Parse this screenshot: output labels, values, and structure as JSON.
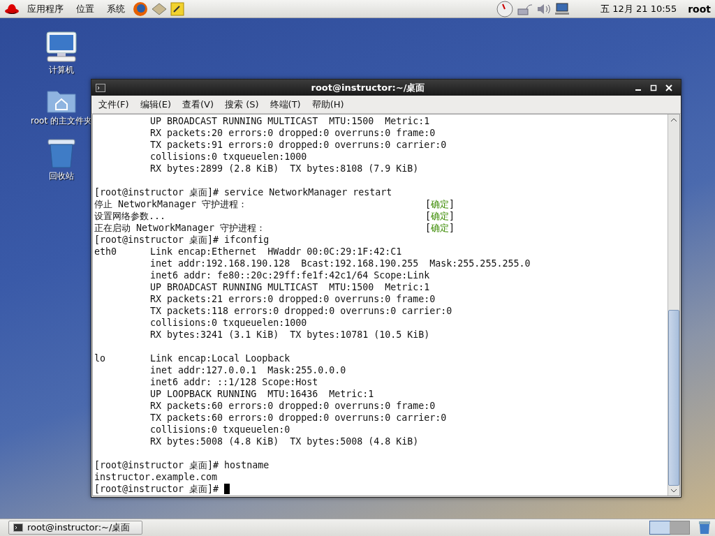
{
  "top_panel": {
    "menus": [
      "应用程序",
      "位置",
      "系统"
    ],
    "clock": "五 12月 21 10:55",
    "user": "root"
  },
  "desktop_icons": [
    {
      "kind": "computer",
      "label": "计算机"
    },
    {
      "kind": "home",
      "label": "root 的主文件夹"
    },
    {
      "kind": "trash",
      "label": "回收站"
    }
  ],
  "terminal": {
    "title": "root@instructor:~/桌面",
    "menu": [
      "文件(F)",
      "编辑(E)",
      "查看(V)",
      "搜索 (S)",
      "终端(T)",
      "帮助(H)"
    ],
    "lines": [
      {
        "kind": "text",
        "text": "          UP BROADCAST RUNNING MULTICAST  MTU:1500  Metric:1"
      },
      {
        "kind": "text",
        "text": "          RX packets:20 errors:0 dropped:0 overruns:0 frame:0"
      },
      {
        "kind": "text",
        "text": "          TX packets:91 errors:0 dropped:0 overruns:0 carrier:0"
      },
      {
        "kind": "text",
        "text": "          collisions:0 txqueuelen:1000"
      },
      {
        "kind": "text",
        "text": "          RX bytes:2899 (2.8 KiB)  TX bytes:8108 (7.9 KiB)"
      },
      {
        "kind": "blank"
      },
      {
        "kind": "text",
        "text": "[root@instructor 桌面]# service NetworkManager restart"
      },
      {
        "kind": "status",
        "text": "停止 NetworkManager 守护进程：",
        "open": "[",
        "status": "确定",
        "close": "]"
      },
      {
        "kind": "status",
        "text": "设置网络参数...",
        "open": "[",
        "status": "确定",
        "close": "]"
      },
      {
        "kind": "status",
        "text": "正在启动 NetworkManager 守护进程：",
        "open": "[",
        "status": "确定",
        "close": "]"
      },
      {
        "kind": "text",
        "text": "[root@instructor 桌面]# ifconfig"
      },
      {
        "kind": "text",
        "text": "eth0      Link encap:Ethernet  HWaddr 00:0C:29:1F:42:C1"
      },
      {
        "kind": "text",
        "text": "          inet addr:192.168.190.128  Bcast:192.168.190.255  Mask:255.255.255.0"
      },
      {
        "kind": "text",
        "text": "          inet6 addr: fe80::20c:29ff:fe1f:42c1/64 Scope:Link"
      },
      {
        "kind": "text",
        "text": "          UP BROADCAST RUNNING MULTICAST  MTU:1500  Metric:1"
      },
      {
        "kind": "text",
        "text": "          RX packets:21 errors:0 dropped:0 overruns:0 frame:0"
      },
      {
        "kind": "text",
        "text": "          TX packets:118 errors:0 dropped:0 overruns:0 carrier:0"
      },
      {
        "kind": "text",
        "text": "          collisions:0 txqueuelen:1000"
      },
      {
        "kind": "text",
        "text": "          RX bytes:3241 (3.1 KiB)  TX bytes:10781 (10.5 KiB)"
      },
      {
        "kind": "blank"
      },
      {
        "kind": "text",
        "text": "lo        Link encap:Local Loopback"
      },
      {
        "kind": "text",
        "text": "          inet addr:127.0.0.1  Mask:255.0.0.0"
      },
      {
        "kind": "text",
        "text": "          inet6 addr: ::1/128 Scope:Host"
      },
      {
        "kind": "text",
        "text": "          UP LOOPBACK RUNNING  MTU:16436  Metric:1"
      },
      {
        "kind": "text",
        "text": "          RX packets:60 errors:0 dropped:0 overruns:0 frame:0"
      },
      {
        "kind": "text",
        "text": "          TX packets:60 errors:0 dropped:0 overruns:0 carrier:0"
      },
      {
        "kind": "text",
        "text": "          collisions:0 txqueuelen:0"
      },
      {
        "kind": "text",
        "text": "          RX bytes:5008 (4.8 KiB)  TX bytes:5008 (4.8 KiB)"
      },
      {
        "kind": "blank"
      },
      {
        "kind": "text",
        "text": "[root@instructor 桌面]# hostname"
      },
      {
        "kind": "text",
        "text": "instructor.example.com"
      },
      {
        "kind": "prompt",
        "text": "[root@instructor 桌面]# "
      }
    ]
  },
  "taskbar": {
    "tasks": [
      {
        "label": "root@instructor:~/桌面",
        "selected": false
      }
    ],
    "workspaces": [
      {
        "selected": true
      },
      {
        "selected": false
      }
    ]
  }
}
